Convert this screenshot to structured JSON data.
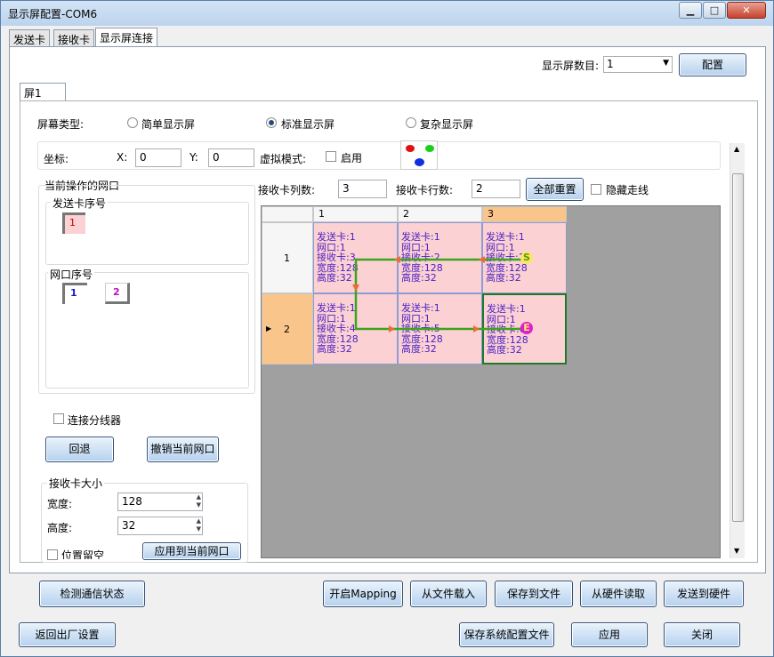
{
  "window": {
    "title": "显示屏配置-COM6",
    "min_icon": "minimize-icon",
    "max_icon": "maximize-icon",
    "close_icon": "close-icon"
  },
  "tabs": [
    "发送卡",
    "接收卡",
    "显示屏连接"
  ],
  "screen_count": {
    "label": "显示屏数目:",
    "value": "1",
    "config_button": "配置"
  },
  "screen_tab": "屏1",
  "screen_type": {
    "label": "屏幕类型:",
    "options": [
      "简单显示屏",
      "标准显示屏",
      "复杂显示屏"
    ],
    "selected": "标准显示屏"
  },
  "coords": {
    "label": "坐标:",
    "x_label": "X:",
    "x": "0",
    "y_label": "Y:",
    "y": "0",
    "virtual_label": "虚拟模式:",
    "enable_label": "启用"
  },
  "current_port": {
    "title": "当前操作的网口",
    "sender_title": "发送卡序号",
    "sender_item": "1",
    "port_title": "网口序号",
    "ports": [
      "1",
      "2"
    ]
  },
  "receiver_cols": {
    "label": "接收卡列数:",
    "value": "3"
  },
  "receiver_rows": {
    "label": "接收卡行数:",
    "value": "2"
  },
  "reset_all": "全部重置",
  "hide_route": "隐藏走线",
  "grid": {
    "col_headers": [
      "1",
      "2",
      "3"
    ],
    "row_headers": [
      "1",
      "2"
    ],
    "rows": [
      [
        {
          "l1": "发送卡:1",
          "l2": "网口:1",
          "l3": "接收卡:3",
          "l4": "宽度:128",
          "l5": "高度:32"
        },
        {
          "l1": "发送卡:1",
          "l2": "网口:1",
          "l3": "接收卡:2",
          "l4": "宽度:128",
          "l5": "高度:32"
        },
        {
          "l1": "发送卡:1",
          "l2": "网口:1",
          "l3": "接收卡:1",
          "l4": "宽度:128",
          "l5": "高度:32"
        }
      ],
      [
        {
          "l1": "发送卡:1",
          "l2": "网口:1",
          "l3": "接收卡:4",
          "l4": "宽度:128",
          "l5": "高度:32"
        },
        {
          "l1": "发送卡:1",
          "l2": "网口:1",
          "l3": "接收卡:5",
          "l4": "宽度:128",
          "l5": "高度:32"
        },
        {
          "l1": "发送卡:1",
          "l2": "网口:1",
          "l3": "接收卡:6",
          "l4": "宽度:128",
          "l5": "高度:32"
        }
      ]
    ],
    "start_marker": "S",
    "end_marker": "E"
  },
  "connect_splitter": "连接分线器",
  "back_button": "回退",
  "undo_port_button": "撤销当前网口",
  "card_size": {
    "title": "接收卡大小",
    "width_label": "宽度:",
    "width": "128",
    "height_label": "高度:",
    "height": "32",
    "reserve_label": "位置留空",
    "apply_button": "应用到当前网口"
  },
  "bottom": {
    "detect": "检测通信状态",
    "mapping": "开启Mapping",
    "load_file": "从文件载入",
    "save_file": "保存到文件",
    "read_hw": "从硬件读取",
    "send_hw": "发送到硬件"
  },
  "footer": {
    "reset_factory": "返回出厂设置",
    "save_config": "保存系统配置文件",
    "ok": "应用",
    "close": "关闭"
  },
  "colors": {
    "accent": "#2a4b7a",
    "cell_bg": "#fcd1d3",
    "header_highlight": "#f9c58a",
    "route": "#3aa51f",
    "arrow": "#ee6a3a"
  }
}
